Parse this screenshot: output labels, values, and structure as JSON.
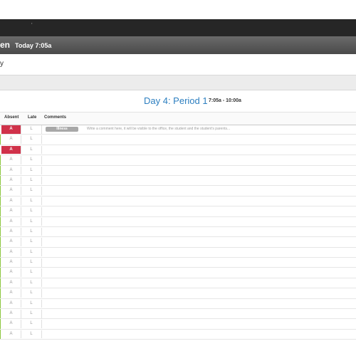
{
  "topbar": {
    "glyph": "'"
  },
  "header": {
    "name_fragment": "en",
    "today": "Today 7:05a"
  },
  "subline": "y",
  "period": {
    "title": "Day 4: Period 1",
    "time": "7:05a - 10:00a"
  },
  "columns": {
    "absent": "Absent",
    "late": "Late",
    "comments": "Comments"
  },
  "colors": {
    "absent_red": "#d0324a",
    "present_green": "#8cc63f",
    "link_blue": "#2d7fc0"
  },
  "rows": [
    {
      "absent_label": "A",
      "late_label": "L",
      "absent": true,
      "badge": "Illness",
      "comment": "Write a comment here, it will be visible to the office, the student and the student's parents..."
    },
    {
      "absent_label": "A",
      "late_label": "L",
      "absent": false
    },
    {
      "absent_label": "A",
      "late_label": "L",
      "absent": true
    },
    {
      "absent_label": "A",
      "late_label": "L",
      "absent": false
    },
    {
      "absent_label": "A",
      "late_label": "L",
      "absent": false
    },
    {
      "absent_label": "A",
      "late_label": "L",
      "absent": false
    },
    {
      "absent_label": "A",
      "late_label": "L",
      "absent": false
    },
    {
      "absent_label": "A",
      "late_label": "L",
      "absent": false
    },
    {
      "absent_label": "A",
      "late_label": "L",
      "absent": false
    },
    {
      "absent_label": "A",
      "late_label": "L",
      "absent": false
    },
    {
      "absent_label": "A",
      "late_label": "L",
      "absent": false
    },
    {
      "absent_label": "A",
      "late_label": "L",
      "absent": false
    },
    {
      "absent_label": "A",
      "late_label": "L",
      "absent": false
    },
    {
      "absent_label": "A",
      "late_label": "L",
      "absent": false
    },
    {
      "absent_label": "A",
      "late_label": "L",
      "absent": false
    },
    {
      "absent_label": "A",
      "late_label": "L",
      "absent": false
    },
    {
      "absent_label": "A",
      "late_label": "L",
      "absent": false
    },
    {
      "absent_label": "A",
      "late_label": "L",
      "absent": false
    },
    {
      "absent_label": "A",
      "late_label": "L",
      "absent": false
    },
    {
      "absent_label": "A",
      "late_label": "L",
      "absent": false
    },
    {
      "absent_label": "A",
      "late_label": "L",
      "absent": false
    }
  ]
}
